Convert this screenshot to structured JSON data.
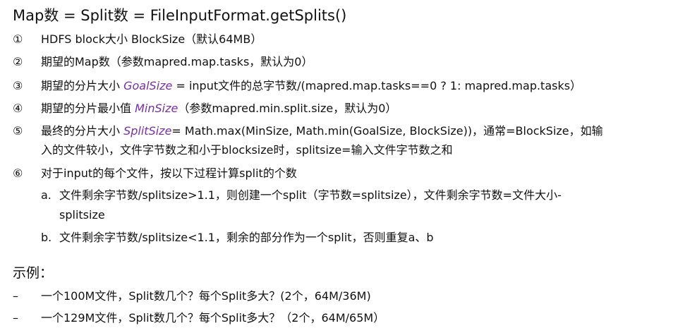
{
  "title": "Map数 = Split数 = FileInputFormat.getSplits()",
  "items": [
    {
      "num": "①",
      "text": "HDFS block大小 BlockSize（默认64MB）"
    },
    {
      "num": "②",
      "text": "期望的Map数（参数mapred.map.tasks，默认为0）"
    },
    {
      "num": "③",
      "pre": "期望的分片大小 ",
      "var": "GoalSize",
      "post": " = input文件的总字节数/(mapred.map.tasks==0 ? 1: mapred.map.tasks）"
    },
    {
      "num": "④",
      "pre": "期望的分片最小值 ",
      "var": "MinSize",
      "post": "（参数mapred.min.split.size，默认为0）"
    },
    {
      "num": "⑤",
      "pre": "最终的分片大小 ",
      "var": "SplitSize",
      "post": "= Math.max(MinSize, Math.min(GoalSize, BlockSize))，通常=BlockSize，如输",
      "line2": "入的文件较小，文件字节数之和小于blocksize时，splitsize=输入文件字节数之和"
    },
    {
      "num": "⑥",
      "text": "对于input的每个文件，按以下过程计算split的个数"
    }
  ],
  "subitems": [
    {
      "letter": "a.",
      "line1": "文件剩余字节数/splitsize>1.1，则创建一个split（字节数=splitsize），文件剩余字节数=文件大小-",
      "line2": "splitsize"
    },
    {
      "letter": "b.",
      "line1": "文件剩余字节数/splitsize<1.1，剩余的部分作为一个split，否则重复a、b"
    }
  ],
  "example": {
    "title": "示例：",
    "dash": "–",
    "lines": [
      "一个100M文件，Split数几个？每个Split多大？(2个，64M/36M)",
      "一个129M文件，Split数几个？每个Split多大？（2个，64M/65M）"
    ]
  }
}
